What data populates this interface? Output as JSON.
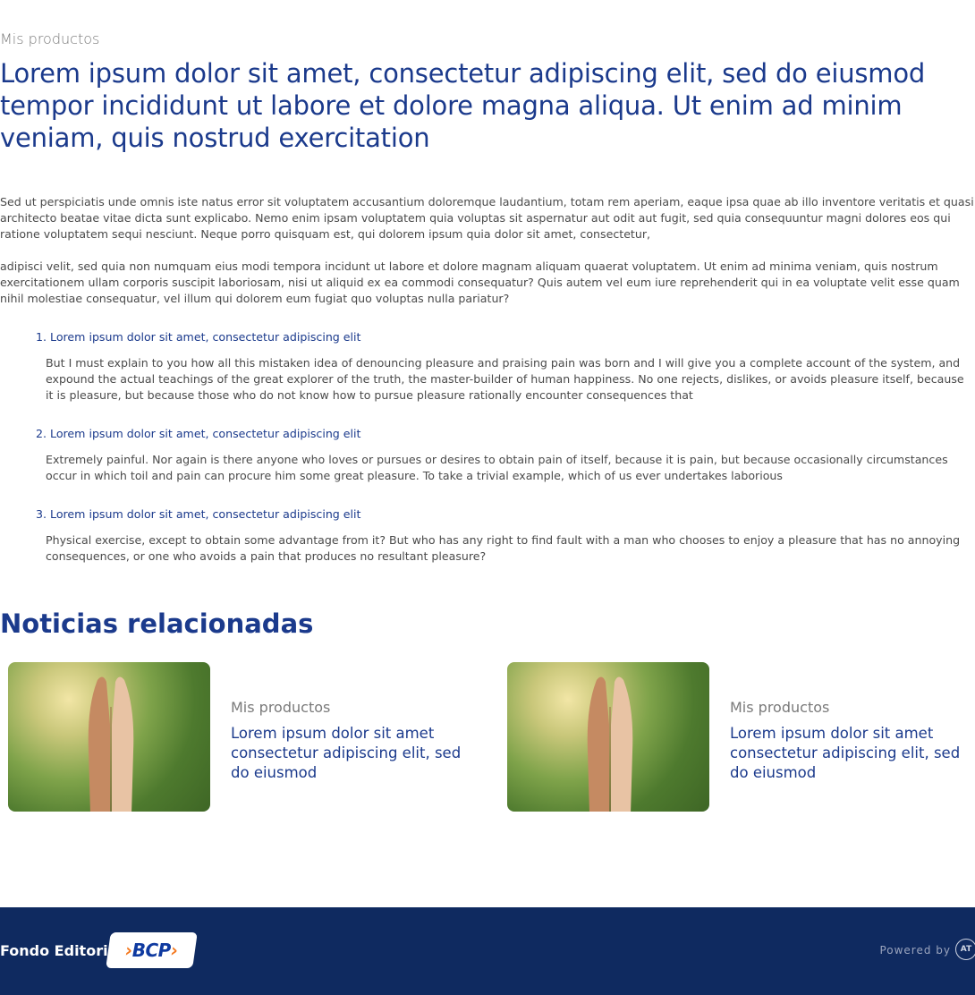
{
  "header": {
    "eyebrow": "Mis productos",
    "title": "Lorem ipsum dolor sit amet, consectetur adipiscing elit, sed do eiusmod tempor incididunt ut labore et dolore magna aliqua. Ut enim ad minim veniam, quis nostrud exercitation"
  },
  "content": {
    "paragraphs": [
      "Sed ut perspiciatis unde omnis iste natus error sit voluptatem accusantium doloremque laudantium, totam rem aperiam, eaque ipsa quae ab illo inventore veritatis et quasi architecto beatae vitae dicta sunt explicabo. Nemo enim ipsam voluptatem quia voluptas sit aspernatur aut odit aut fugit, sed quia consequuntur magni dolores eos qui ratione voluptatem sequi nesciunt. Neque porro quisquam est, qui dolorem ipsum quia dolor sit amet, consectetur,",
      "adipisci velit, sed quia non numquam eius modi tempora incidunt ut labore et dolore magnam aliquam quaerat voluptatem. Ut enim ad minima veniam, quis nostrum exercitationem ullam corporis suscipit laboriosam, nisi ut aliquid ex ea commodi consequatur? Quis autem vel eum iure reprehenderit qui in ea voluptate velit esse quam nihil molestiae consequatur, vel illum qui dolorem eum fugiat quo voluptas nulla pariatur?"
    ],
    "list": [
      {
        "title": "1. Lorem ipsum dolor sit amet, consectetur adipiscing elit",
        "body": "But I must explain to you how all this mistaken idea of denouncing pleasure and praising pain was born and I will give you a complete account of the system, and expound the actual teachings of the great explorer of the truth, the master-builder of human happiness. No one rejects, dislikes, or avoids pleasure itself, because it is pleasure, but because those who do not know how to pursue pleasure rationally encounter consequences that"
      },
      {
        "title": "2. Lorem ipsum dolor sit amet, consectetur adipiscing elit",
        "body": "Extremely painful. Nor again is there anyone who loves or pursues or desires to obtain pain of itself, because it is pain, but because occasionally circumstances occur in which toil and pain can procure him some great pleasure. To take a trivial example, which of us ever undertakes laborious"
      },
      {
        "title": "3. Lorem ipsum dolor sit amet, consectetur adipiscing elit",
        "body": "Physical exercise, except to obtain some advantage from it? But who has any right to find fault with a man who chooses to enjoy a pleasure that has no annoying consequences, or one who avoids a pain that produces no resultant pleasure?"
      }
    ]
  },
  "related": {
    "title": "Noticias relacionadas",
    "cards": [
      {
        "eyebrow": "Mis productos",
        "title": "Lorem ipsum dolor sit amet consectetur adipiscing elit, sed do eiusmod"
      },
      {
        "eyebrow": "Mis productos",
        "title": "Lorem ipsum dolor sit amet consectetur adipiscing elit, sed do eiusmod"
      }
    ]
  },
  "footer": {
    "brand": "Fondo Editorial",
    "logo_text": "BCP",
    "powered_by": "Powered by",
    "powered_logo": "AT"
  },
  "colors": {
    "accent": "#1b3a8c",
    "footer_bg": "#0f2a60",
    "logo_orange": "#f47920"
  }
}
